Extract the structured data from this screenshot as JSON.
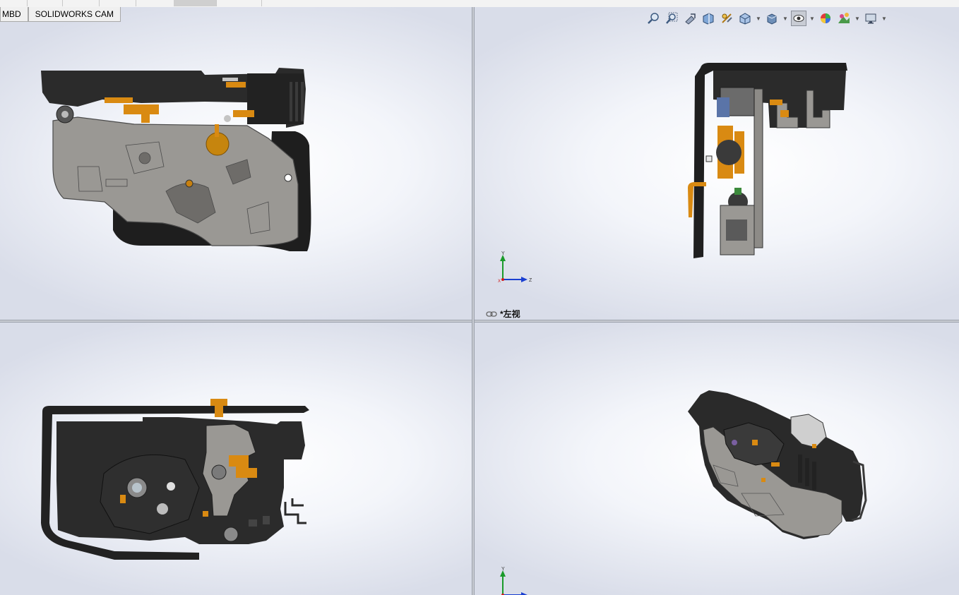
{
  "tabs": [
    {
      "label": "MBD"
    },
    {
      "label": "SOLIDWORKS CAM"
    }
  ],
  "heads_up_toolbar": {
    "icons": [
      "zoom-to-fit-icon",
      "zoom-to-area-icon",
      "previous-view-icon",
      "section-view-icon",
      "dynamic-annotation-icon",
      "view-orientation-icon",
      "display-style-icon",
      "hide-show-items-icon",
      "edit-appearance-icon",
      "apply-scene-icon",
      "view-settings-icon"
    ]
  },
  "viewports": {
    "top_right": {
      "view_name": "*左视"
    }
  },
  "triad": {
    "y_label": "Y",
    "z_label": "Z",
    "x_label": "X"
  },
  "colors": {
    "housing_gray": "#9a9894",
    "part_black": "#2b2b2b",
    "part_orange": "#d98a12",
    "viewport_bg": "#e6e9f1",
    "triad_y": "#1a9a2a",
    "triad_z": "#1a3fd1",
    "triad_x": "#d01a1a"
  }
}
